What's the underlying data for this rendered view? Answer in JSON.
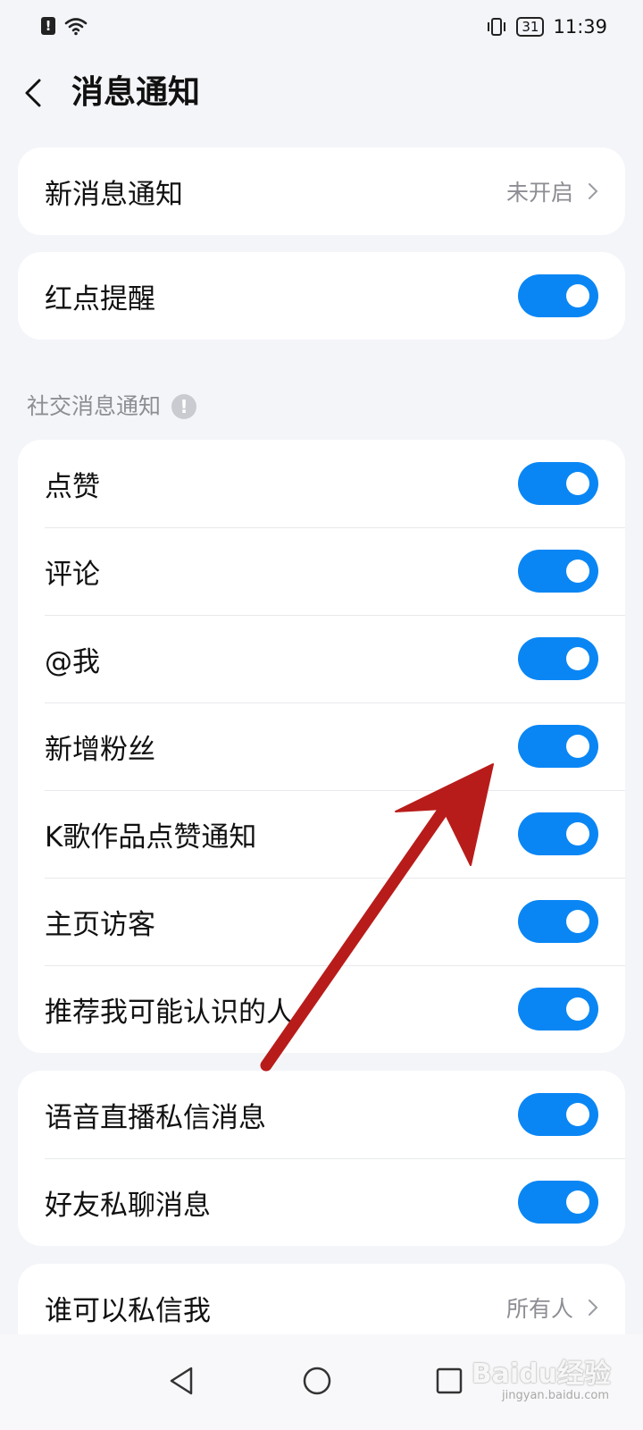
{
  "status_bar": {
    "time": "11:39",
    "battery_level": "31",
    "icons": [
      "warning-icon",
      "wifi-icon",
      "vibrate-icon",
      "battery-icon"
    ]
  },
  "header": {
    "title": "消息通知",
    "back_icon": "back-chevron-icon"
  },
  "notification_card": {
    "label": "新消息通知",
    "value": "未开启"
  },
  "red_dot": {
    "label": "红点提醒",
    "enabled": true
  },
  "social_section": {
    "title": "社交消息通知",
    "items": [
      {
        "label": "点赞",
        "enabled": true
      },
      {
        "label": "评论",
        "enabled": true
      },
      {
        "label": "@我",
        "enabled": true
      },
      {
        "label": "新增粉丝",
        "enabled": true
      },
      {
        "label": "K歌作品点赞通知",
        "enabled": true
      },
      {
        "label": "主页访客",
        "enabled": true
      },
      {
        "label": "推荐我可能认识的人",
        "enabled": true
      }
    ]
  },
  "message_section": {
    "items": [
      {
        "label": "语音直播私信消息",
        "enabled": true
      },
      {
        "label": "好友私聊消息",
        "enabled": true
      }
    ]
  },
  "privacy_card": {
    "label": "谁可以私信我",
    "value": "所有人"
  },
  "nav_bar": {
    "buttons": [
      "back-triangle-icon",
      "home-circle-icon",
      "recents-square-icon"
    ]
  },
  "watermark": {
    "text": "Baidu经验",
    "sub": "jingyan.baidu.com"
  },
  "colors": {
    "toggle_on": "#0a86f4",
    "annotation_arrow": "#b81c1a",
    "background": "#f4f5f9"
  }
}
